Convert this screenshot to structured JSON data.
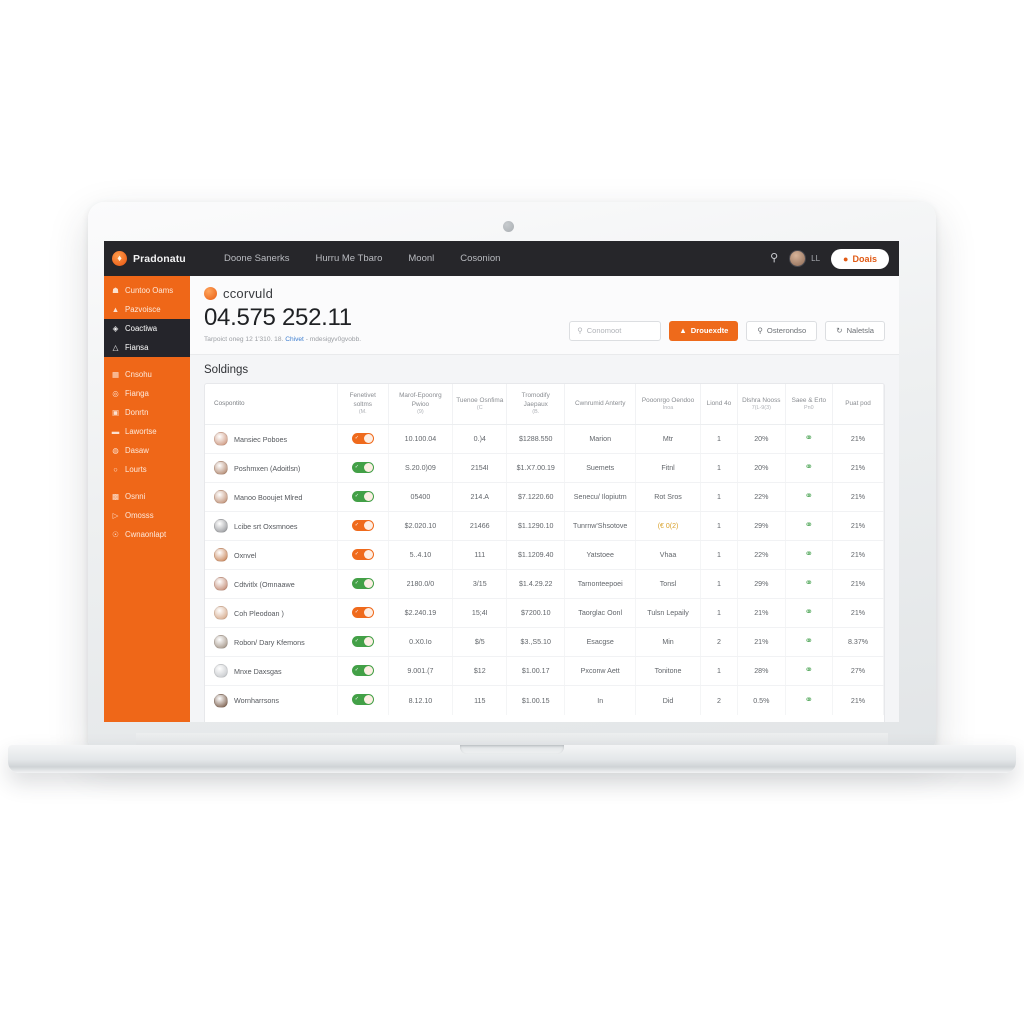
{
  "brand": {
    "name": "Pradonatu",
    "mark_icon": "flame-icon"
  },
  "topnav": {
    "items": [
      {
        "label": "Doone Sanerks"
      },
      {
        "label": "Hurru Me Tbaro"
      },
      {
        "label": "Moonl"
      },
      {
        "label": "Cosonion"
      }
    ],
    "search_icon": "search-icon",
    "user_name": "LL",
    "cta_label": "Doais",
    "cta_icon": "user-icon"
  },
  "sidebar": {
    "items": [
      {
        "label": "Cuntoo Oams",
        "icon": "home-icon",
        "active": false
      },
      {
        "label": "Pazvoisce",
        "icon": "user-icon",
        "active": false
      },
      {
        "label": "Coactiwa",
        "icon": "droplet-icon",
        "active": true
      },
      {
        "label": "Fiansa",
        "icon": "alert-icon",
        "active": true
      },
      {
        "label": "Cnsohu",
        "icon": "calendar-icon",
        "active": false
      },
      {
        "label": "Fianga",
        "icon": "clock-icon",
        "active": false
      },
      {
        "label": "Donrtn",
        "icon": "card-icon",
        "active": false
      },
      {
        "label": "Lawortse",
        "icon": "book-icon",
        "active": false
      },
      {
        "label": "Dasaw",
        "icon": "circle-icon",
        "active": false
      },
      {
        "label": "Lourts",
        "icon": "timer-icon",
        "active": false
      },
      {
        "label": "Osnni",
        "icon": "tag-icon",
        "active": false
      },
      {
        "label": "Omosss",
        "icon": "brush-icon",
        "active": false
      },
      {
        "label": "Cwnaonlapt",
        "icon": "lock-icon",
        "active": false
      }
    ]
  },
  "hero": {
    "kicker": "ccorvuld",
    "kicker_icon": "target-icon",
    "number": "04.575 252.11",
    "sub_before": "Tarpoict oneg 12 1'310. 18. ",
    "sub_link": "Chivet",
    "sub_after": " - mdesigyv0gvobb.",
    "search_placeholder": "Conomoot",
    "search_icon": "search-icon",
    "actions": [
      {
        "label": "Drouexdte",
        "icon": "user-plus-icon",
        "style": "primary"
      },
      {
        "label": "Osterondso",
        "icon": "filter-icon",
        "style": "ghost"
      },
      {
        "label": "Naletsla",
        "icon": "refresh-icon",
        "style": "ghost"
      }
    ]
  },
  "table": {
    "title": "Soldings",
    "columns": [
      {
        "label": "Cospontito",
        "sub": ""
      },
      {
        "label": "Fenetivet soltms",
        "sub": "(M."
      },
      {
        "label": "Marof-Epoonrg Pwioo",
        "sub": "(9)"
      },
      {
        "label": "Tuenoe Osnfima",
        "sub": "(C"
      },
      {
        "label": "Tromodify Jaepaux",
        "sub": "(B."
      },
      {
        "label": "Cwnrumid Anterty",
        "sub": ""
      },
      {
        "label": "Pooonrgo Oendoo",
        "sub": "Inoa"
      },
      {
        "label": "Liond 4o",
        "sub": ""
      },
      {
        "label": "Dlshra Nooss",
        "sub": "7(L-9(3)"
      },
      {
        "label": "Saee & Erto",
        "sub": "Pn0"
      },
      {
        "label": "Puat pod",
        "sub": ""
      }
    ],
    "rows": [
      {
        "name": "Mansiec Poboes",
        "avatar": "#c98d72",
        "toggle": "on-orange",
        "c2": "10.100.04",
        "c3": "0.)4",
        "c4": "$1288.550",
        "c5": "Marion",
        "c6": "Mtr",
        "c7": "1",
        "c8": "20%",
        "status": "pin",
        "c10": "21%"
      },
      {
        "name": "Poshmxen (Adoitlsn)",
        "avatar": "#a97a5f",
        "toggle": "on-green",
        "c2": "S.20.0)09",
        "c3": "2154I",
        "c4": "$1.X7.00.19",
        "c5": "Suemets",
        "c6": "Fitnl",
        "c7": "1",
        "c8": "20%",
        "status": "pin",
        "c10": "21%"
      },
      {
        "name": "Manoo Booujet Mlred",
        "avatar": "#b98466",
        "toggle": "on-green",
        "c2": "05400",
        "c3": "214.A",
        "c4": "$7.1220.60",
        "c5": "Senecu/ Ilopiutm",
        "c6": "Rot Sros",
        "c7": "1",
        "c8": "22%",
        "status": "pin",
        "c10": "21%"
      },
      {
        "name": "Lcibe srt Oxsmnoes",
        "avatar": "#8d8f93",
        "toggle": "on-orange",
        "c2": "$2.020.10",
        "c3": "21466",
        "c4": "$1.1290.10",
        "c5": "Tunrnw'Shsotove",
        "c6": "(€ 0(2)",
        "c7": "1",
        "c8": "29%",
        "status": "pin",
        "c10": "21%",
        "c6_warn": true
      },
      {
        "name": "Oxnvel",
        "avatar": "#c47a4a",
        "toggle": "on-orange",
        "c2": "5..4.10",
        "c3": "111",
        "c4": "$1.1209.40",
        "c5": "Yatstoee",
        "c6": "Vhaa",
        "c7": "1",
        "c8": "22%",
        "status": "pin",
        "c10": "21%"
      },
      {
        "name": "Cdtvitlx (Omnaawe",
        "avatar": "#bd7f66",
        "toggle": "on-green",
        "c2": "2180.0/0",
        "c3": "3/15",
        "c4": "$1.4.29.22",
        "c5": "Tarnonteepoei",
        "c6": "Tonsl",
        "c7": "1",
        "c8": "29%",
        "status": "pin",
        "c10": "21%"
      },
      {
        "name": "Coh Pleodoan )",
        "avatar": "#d1a07e",
        "toggle": "on-orange",
        "c2": "$2.240.19",
        "c3": "15;4I",
        "c4": "$7200.10",
        "c5": "Taorglac Oonl",
        "c6": "Tulsn Lepaily",
        "c7": "1",
        "c8": "21%",
        "status": "pin",
        "c10": "21%"
      },
      {
        "name": "Robon/ Dary Kfemons",
        "avatar": "#9a8a7b",
        "toggle": "on-green",
        "c2": "0.X0.Io",
        "c3": "$/5",
        "c4": "$3.,S5.10",
        "c5": "Esacgse",
        "c6": "Min",
        "c7": "2",
        "c8": "21%",
        "status": "pin",
        "c10": "8.37%"
      },
      {
        "name": "Mnxe Daxsgas",
        "avatar": "#c0c3c7",
        "toggle": "on-green",
        "c2": "9.001.(7",
        "c3": "$12",
        "c4": "$1.00.17",
        "c5": "Pxconw Aett",
        "c6": "Tonitone",
        "c7": "1",
        "c8": "28%",
        "status": "pin",
        "c10": "27%"
      },
      {
        "name": "Wornharrsons",
        "avatar": "#6e4e3a",
        "toggle": "on-green",
        "c2": "8.12.10",
        "c3": "115",
        "c4": "$1.00.15",
        "c5": "In",
        "c6": "Did",
        "c7": "2",
        "c8": "0.5%",
        "status": "pin",
        "c10": "21%"
      }
    ]
  },
  "colors": {
    "accent": "#ef6718",
    "dark": "#26262a",
    "green": "#43a047",
    "link": "#3f7fd0"
  }
}
